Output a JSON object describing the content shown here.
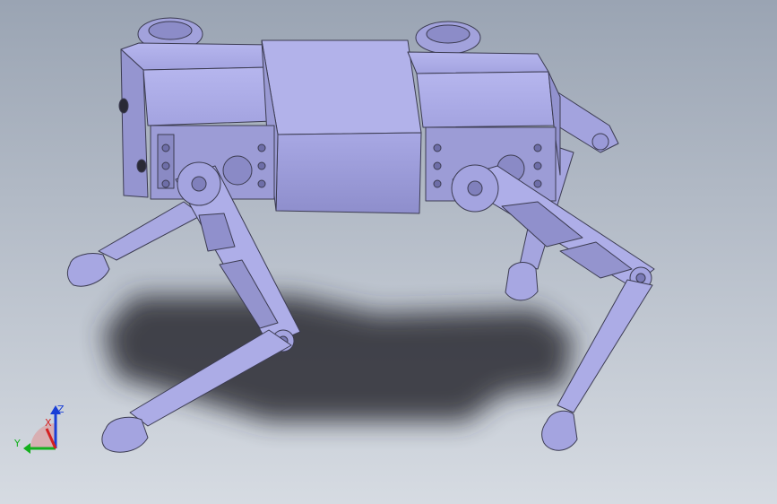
{
  "viewport": {
    "background_top": "#9aa4b3",
    "background_bottom": "#d6dbe2"
  },
  "model": {
    "body_color": "#b0b0e8",
    "body_shade": "#9797d2",
    "edge_color": "#3c3c52"
  },
  "triad": {
    "x_label": "X",
    "y_label": "Y",
    "z_label": "Z",
    "x_color": "#d42020",
    "y_color": "#14b01e",
    "z_color": "#1a3fd6"
  }
}
